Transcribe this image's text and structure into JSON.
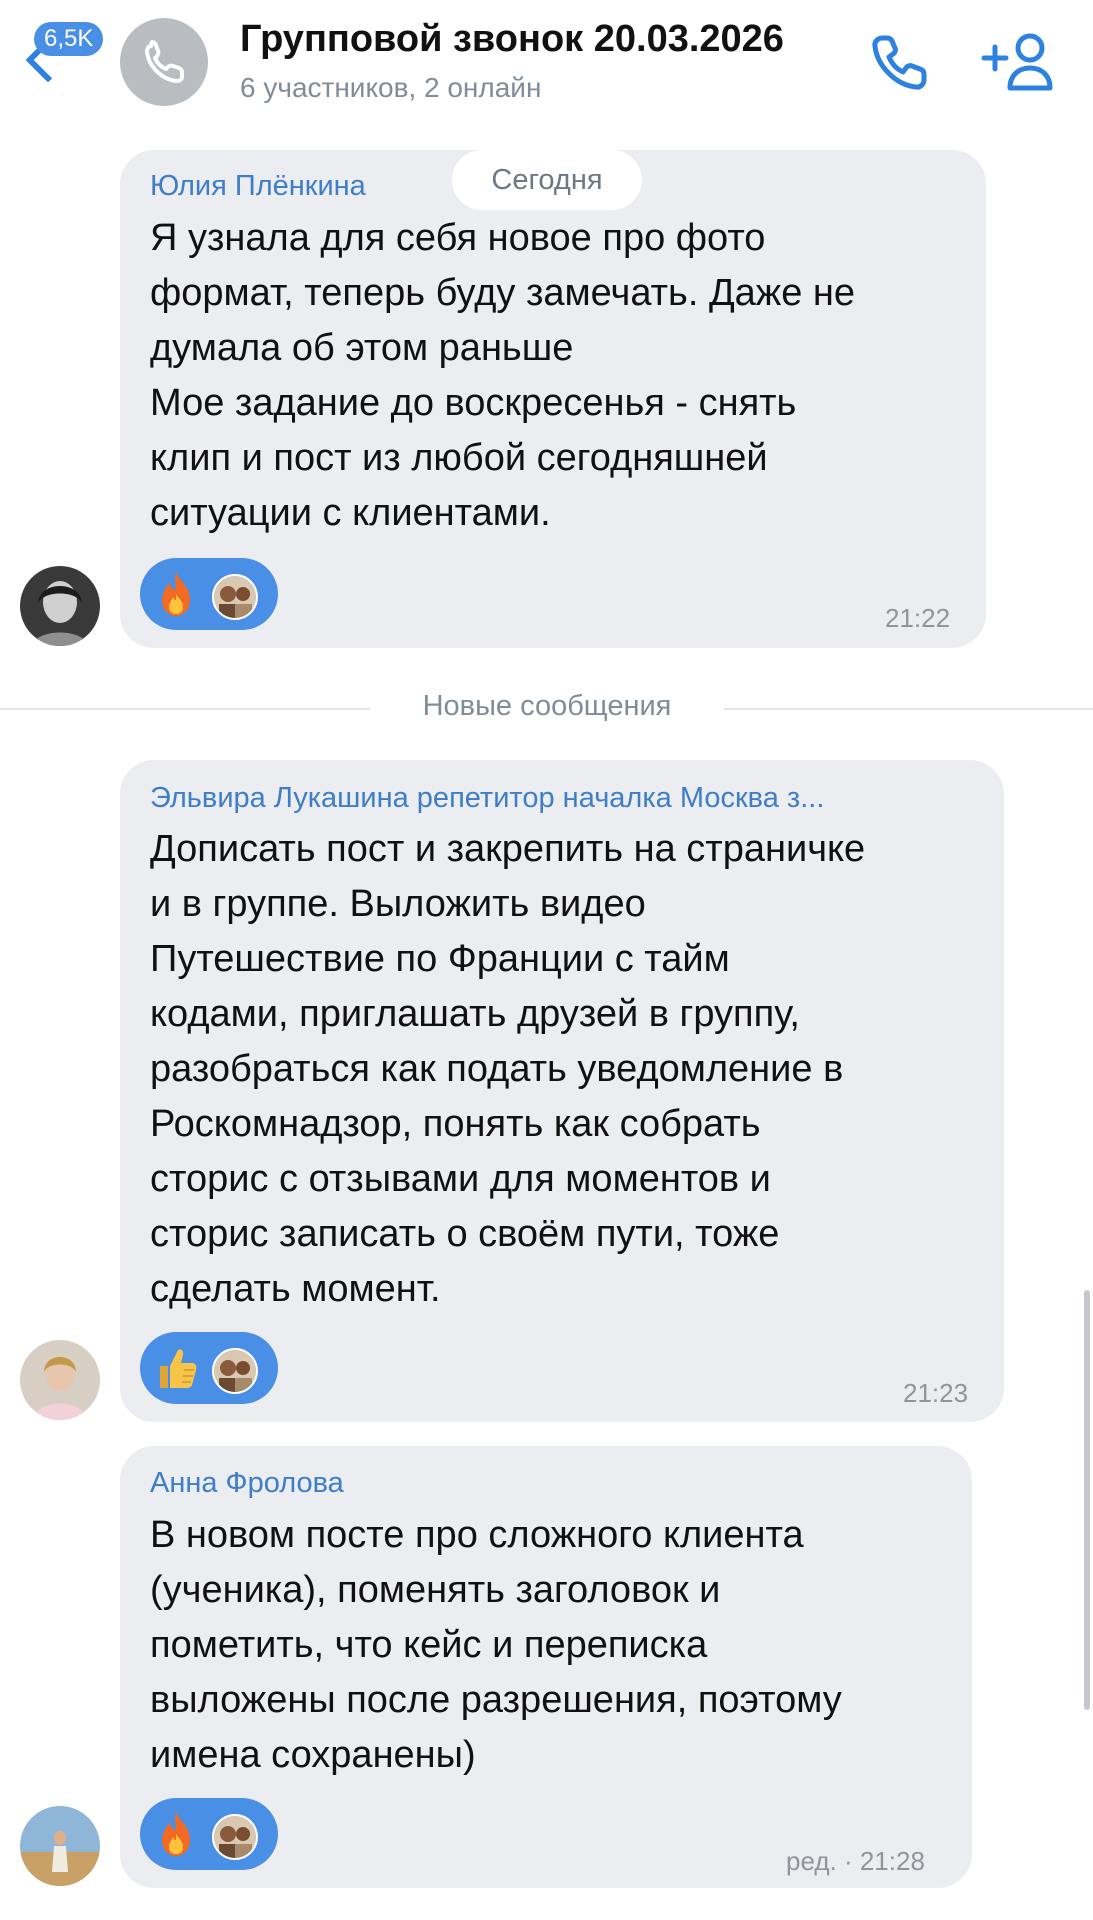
{
  "header": {
    "unread_count": "6,5K",
    "title": "Групповой звонок 20.03.2026",
    "subtitle": "6 участников, 2 онлайн"
  },
  "date_divider": "Сегодня",
  "new_messages_divider": "Новые сообщения",
  "messages": [
    {
      "sender": "Юлия Плёнкина",
      "lines": [
        "Я узнала для себя новое про фото",
        "формат, теперь буду замечать. Даже не",
        "думала об этом раньше",
        "Мое задание до воскресенья - снять",
        "клип и пост из любой сегодняшней",
        "ситуации с клиентами."
      ],
      "reaction": "fire",
      "time": "21:22"
    },
    {
      "sender": "Эльвира Лукашина репетитор началка Москва з...",
      "lines": [
        "Дописать пост и закрепить на страничке",
        "и в группе. Выложить видео",
        "Путешествие по Франции с тайм",
        "кодами, приглашать друзей в группу,",
        "разобраться как подать уведомление в",
        "Роскомнадзор, понять как собрать",
        "сторис с отзывами для моментов и",
        "сторис записать о своём пути, тоже",
        "сделать момент."
      ],
      "reaction": "thumbs-up",
      "time": "21:23"
    },
    {
      "sender": "Анна Фролова",
      "lines": [
        "В новом посте про сложного клиента",
        "(ученика), поменять заголовок и",
        "пометить, что кейс и переписка",
        "выложены после разрешения, поэтому",
        "имена сохранены)"
      ],
      "reaction": "fire",
      "time": "ред. · 21:28"
    }
  ],
  "colors": {
    "accent": "#2d81e0",
    "sender_name": "#3e7ec8",
    "bubble": "#ebedf0",
    "reaction_bg": "#4a8fe6"
  }
}
